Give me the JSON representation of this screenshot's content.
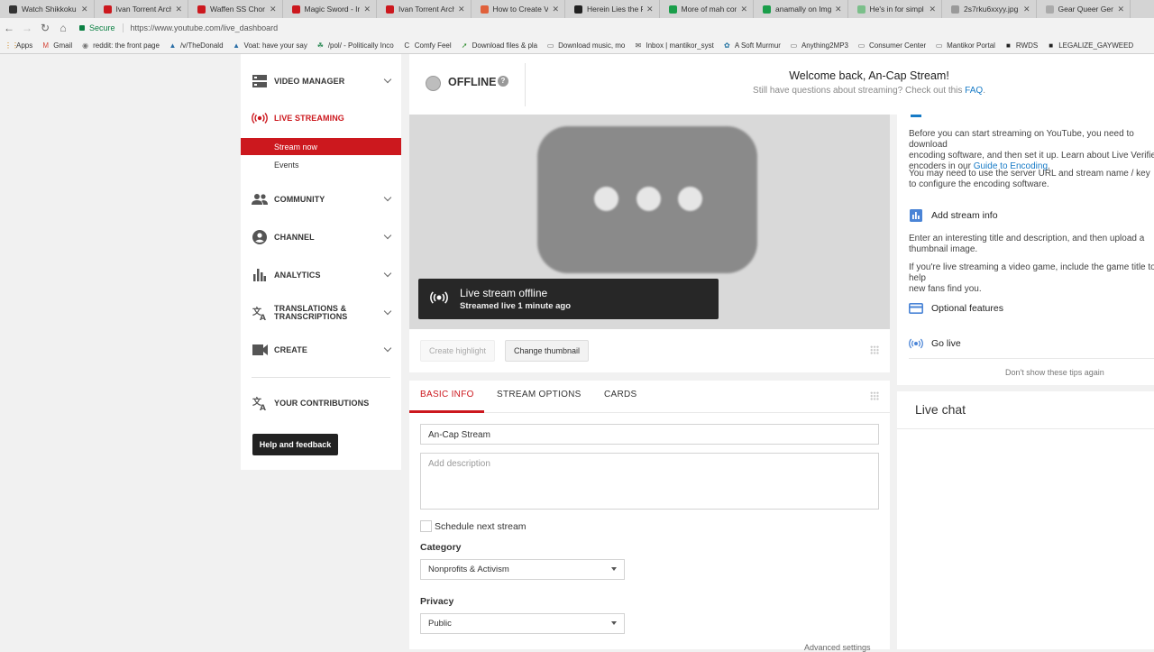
{
  "browser": {
    "tabs": [
      {
        "title": "Watch Shikkoku no",
        "color": "#333333"
      },
      {
        "title": "Ivan Torrent Archi",
        "color": "#cc181e"
      },
      {
        "title": "Waffen SS Chor -",
        "color": "#cc181e"
      },
      {
        "title": "Magic Sword - Imr",
        "color": "#cc181e"
      },
      {
        "title": "Ivan Torrent Archi",
        "color": "#cc181e"
      },
      {
        "title": "How to Create Vi",
        "color": "#e0603a"
      },
      {
        "title": "Herein Lies the Pr",
        "color": "#222222"
      },
      {
        "title": "More of mah com",
        "color": "#1a9e4a"
      },
      {
        "title": "anamally on Imgu",
        "color": "#1a9e4a"
      },
      {
        "title": "He's in for simpl",
        "color": "#7bbf8a"
      },
      {
        "title": "2s7rku6xxyy.jpg",
        "color": "#999999"
      },
      {
        "title": "Gear Queer Gene",
        "color": "#aaaaaa"
      }
    ],
    "tab_close": "✕",
    "secure_label": "Secure",
    "url": "https://www.youtube.com/live_dashboard",
    "bookmarks": [
      {
        "label": "Apps",
        "icon": "apps-icon"
      },
      {
        "label": "Gmail",
        "icon": "gmail-icon"
      },
      {
        "label": "reddit: the front page",
        "icon": "reddit-icon"
      },
      {
        "label": "/v/TheDonald",
        "icon": "voat-icon"
      },
      {
        "label": "Voat: have your say",
        "icon": "voat-icon"
      },
      {
        "label": "/pol/ - Politically Inco",
        "icon": "board-icon"
      },
      {
        "label": "Comfy Feel",
        "icon": "c-icon"
      },
      {
        "label": "Download files & pla",
        "icon": "rocket-icon"
      },
      {
        "label": "Download music, mo",
        "icon": "page-icon"
      },
      {
        "label": "Inbox | mantikor_syst",
        "icon": "mail-icon"
      },
      {
        "label": "A Soft Murmur",
        "icon": "leaf-icon"
      },
      {
        "label": "Anything2MP3",
        "icon": "page-icon"
      },
      {
        "label": "Consumer Center",
        "icon": "page-icon"
      },
      {
        "label": "Mantikor Portal",
        "icon": "page-icon"
      },
      {
        "label": "RWDS",
        "icon": "rwds-icon"
      },
      {
        "label": "LEGALIZE_GAYWEED",
        "icon": "rwds-icon"
      }
    ]
  },
  "sidebar": {
    "video_manager": "VIDEO MANAGER",
    "live_streaming": "LIVE STREAMING",
    "stream_now": "Stream now",
    "events": "Events",
    "community": "COMMUNITY",
    "channel": "CHANNEL",
    "analytics": "ANALYTICS",
    "translations": "TRANSLATIONS &",
    "transcriptions": "TRANSCRIPTIONS",
    "create": "CREATE",
    "your_contributions": "YOUR CONTRIBUTIONS",
    "help_feedback": "Help and feedback"
  },
  "status": {
    "state": "OFFLINE",
    "help": "?",
    "welcome": "Welcome back, An-Cap Stream!",
    "questions": "Still have questions about streaming? Check out this ",
    "faq": "FAQ",
    "period": "."
  },
  "video": {
    "offline_title": "Live stream offline",
    "offline_sub": "Streamed live 1 minute ago"
  },
  "actions": {
    "create_highlight": "Create highlight",
    "change_thumbnail": "Change thumbnail"
  },
  "form": {
    "tabs": [
      "BASIC INFO",
      "STREAM OPTIONS",
      "CARDS"
    ],
    "title_value": "An-Cap Stream",
    "description_placeholder": "Add description",
    "schedule_label": "Schedule next stream",
    "category_label": "Category",
    "category_value": "Nonprofits & Activism",
    "privacy_label": "Privacy",
    "privacy_value": "Public",
    "advanced": "Advanced settings"
  },
  "tips": {
    "p1_a": "Before you can start streaming on YouTube, you need to download",
    "p1_b": "encoding software, and then set it up. Learn about Live Verified",
    "p1_c": "encoders in our ",
    "p1_link": "Guide to Encoding",
    "p1_end": ".",
    "p2_a": "You may need to use the server URL and stream name / key",
    "p2_b": "to configure the encoding software.",
    "add_info": "Add stream info",
    "p3_a": "Enter an interesting title and description, and then upload a",
    "p3_b": "thumbnail image.",
    "p4_a": "If you're live streaming a video game, include the game title to help",
    "p4_b": "new fans find you.",
    "optional": "Optional features",
    "go_live": "Go live",
    "dont_show": "Don't show these tips again"
  },
  "chat": {
    "title": "Live chat"
  },
  "colors": {
    "accent": "#cc181e",
    "link": "#167ac6"
  }
}
